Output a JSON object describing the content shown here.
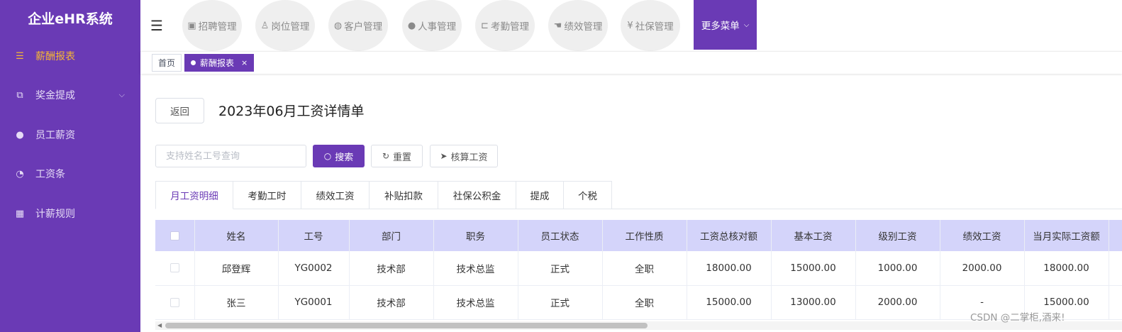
{
  "app": {
    "title": "企业eHR系统"
  },
  "sidebar": {
    "items": [
      {
        "label": "薪酬报表",
        "icon": "list-icon"
      },
      {
        "label": "奖金提成",
        "icon": "puzzle-icon"
      },
      {
        "label": "员工薪资",
        "icon": "users-icon"
      },
      {
        "label": "工资条",
        "icon": "palette-icon"
      },
      {
        "label": "计薪规则",
        "icon": "grid-icon"
      }
    ]
  },
  "topnav": {
    "tabs": [
      {
        "label": "招聘管理",
        "icon": "picture-icon"
      },
      {
        "label": "岗位管理",
        "icon": "thumb-icon"
      },
      {
        "label": "客户管理",
        "icon": "globe-icon"
      },
      {
        "label": "人事管理",
        "icon": "user-icon"
      },
      {
        "label": "考勤管理",
        "icon": "tag-icon"
      },
      {
        "label": "绩效管理",
        "icon": "hand-icon"
      },
      {
        "label": "社保管理",
        "icon": "yen-icon"
      }
    ],
    "more_label": "更多菜单"
  },
  "tagsbar": {
    "home": "首页",
    "current": "薪酬报表"
  },
  "page": {
    "back_label": "返回",
    "title": "2023年06月工资详情单"
  },
  "search": {
    "placeholder": "支持姓名工号查询",
    "search_label": "搜索",
    "reset_label": "重置",
    "calc_label": "核算工资"
  },
  "tabs": [
    "月工资明细",
    "考勤工时",
    "绩效工资",
    "补贴扣款",
    "社保公积金",
    "提成",
    "个税"
  ],
  "table": {
    "headers": [
      "姓名",
      "工号",
      "部门",
      "职务",
      "员工状态",
      "工作性质",
      "工资总核对额",
      "基本工资",
      "级别工资",
      "绩效工资",
      "当月实际工资额"
    ],
    "rows": [
      [
        "邱登辉",
        "YG0002",
        "技术部",
        "技术总监",
        "正式",
        "全职",
        "18000.00",
        "15000.00",
        "1000.00",
        "2000.00",
        "18000.00"
      ],
      [
        "张三",
        "YG0001",
        "技术部",
        "技术总监",
        "正式",
        "全职",
        "15000.00",
        "13000.00",
        "2000.00",
        "-",
        "15000.00"
      ]
    ]
  },
  "watermark": "CSDN @二掌柜,酒来!",
  "colors": {
    "brand": "#6a3ab5",
    "active_menu": "#f5b634",
    "table_header": "#d4d4fa"
  }
}
